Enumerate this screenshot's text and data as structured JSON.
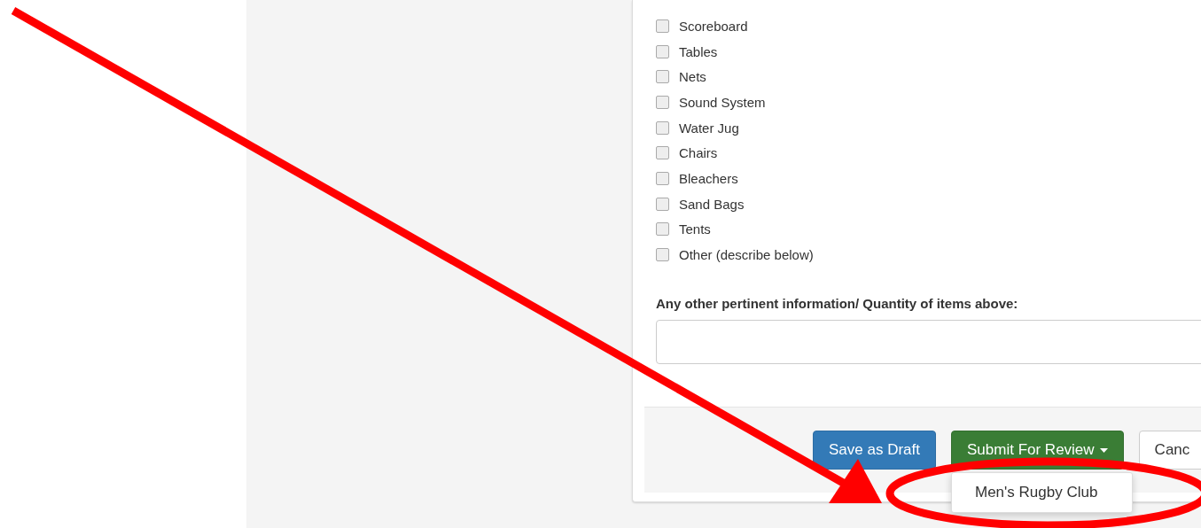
{
  "equipment": [
    {
      "label": "Scoreboard",
      "checked": false
    },
    {
      "label": "Tables",
      "checked": false
    },
    {
      "label": "Nets",
      "checked": false
    },
    {
      "label": "Sound System",
      "checked": false
    },
    {
      "label": "Water Jug",
      "checked": false
    },
    {
      "label": "Chairs",
      "checked": false
    },
    {
      "label": "Bleachers",
      "checked": false
    },
    {
      "label": "Sand Bags",
      "checked": false
    },
    {
      "label": "Tents",
      "checked": false
    },
    {
      "label": "Other (describe below)",
      "checked": false
    }
  ],
  "info_field": {
    "label": "Any other pertinent information/ Quantity of items above:"
  },
  "buttons": {
    "save": "Save as Draft",
    "submit": "Submit For Review",
    "cancel": "Canc"
  },
  "submit_menu": {
    "open": true,
    "items": [
      "Men's Rugby Club"
    ]
  }
}
